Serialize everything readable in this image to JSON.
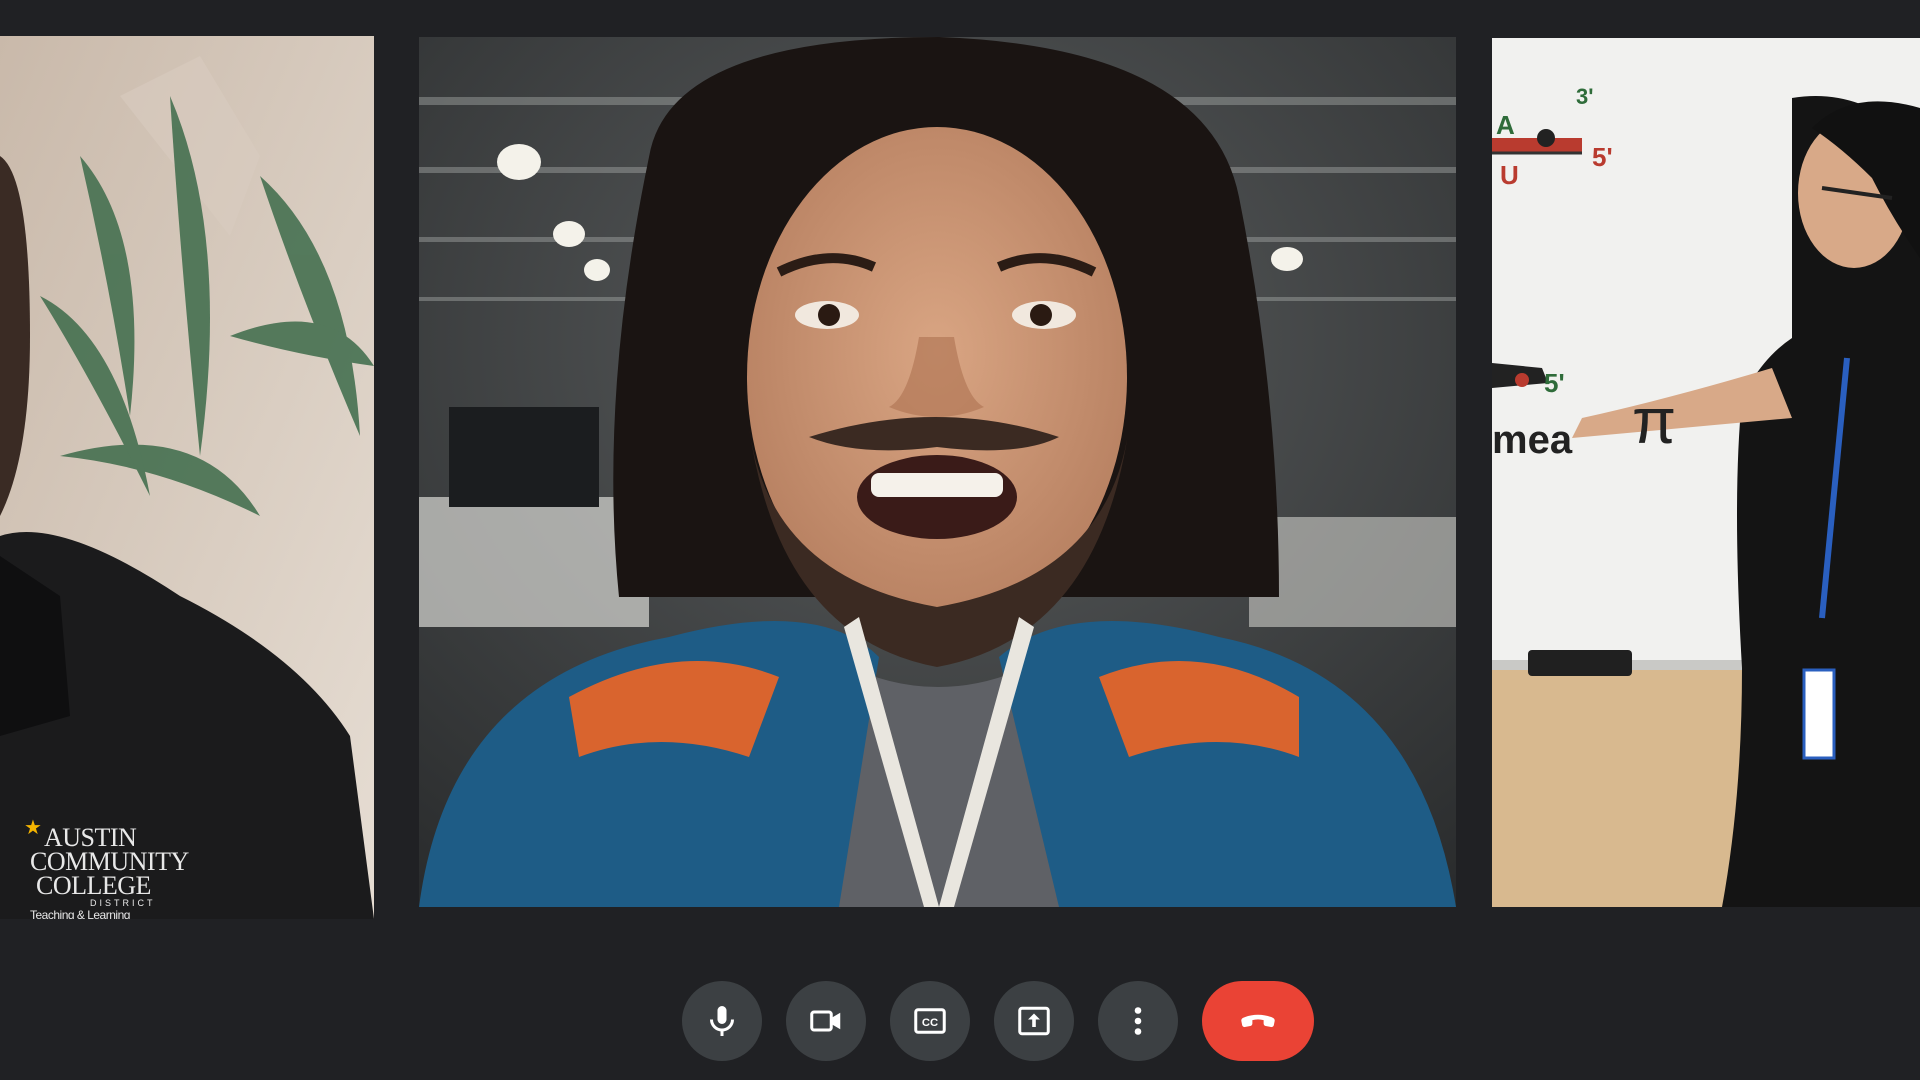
{
  "participants": [
    {
      "id": "left",
      "logo": {
        "line1": "AUSTIN",
        "line2": "COMMUNITY",
        "line3": "COLLEGE",
        "sub": "DISTRICT",
        "tag": "Teaching & Learning"
      }
    },
    {
      "id": "center"
    },
    {
      "id": "right",
      "whiteboard": {
        "a": "A",
        "u": "U",
        "m31": "3'",
        "m5a": "5'",
        "m5b": "5'",
        "pi": "π",
        "mea": "mea"
      }
    }
  ],
  "controls": {
    "mic": {
      "icon": "microphone-icon"
    },
    "camera": {
      "icon": "video-camera-icon"
    },
    "captions": {
      "icon": "closed-captions-icon",
      "label": "CC"
    },
    "share": {
      "icon": "present-screen-icon"
    },
    "more": {
      "icon": "more-options-icon"
    },
    "end_call": {
      "icon": "end-call-icon"
    }
  },
  "colors": {
    "background": "#202124",
    "control_button": "#3c4043",
    "end_call": "#ea4335",
    "icon": "#ffffff"
  }
}
